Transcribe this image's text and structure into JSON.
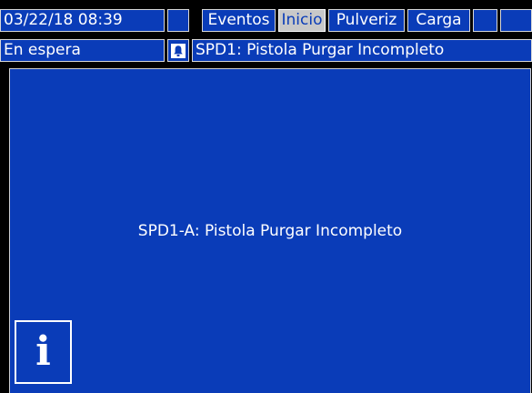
{
  "header": {
    "datetime": "03/22/18 08:39",
    "tabs": [
      {
        "label": "Eventos",
        "active": false
      },
      {
        "label": "Inicio",
        "active": true
      },
      {
        "label": "Pulveriz",
        "active": false
      },
      {
        "label": "Carga",
        "active": false
      }
    ]
  },
  "status": {
    "state": "En espera",
    "alarm_icon": "bell-icon",
    "alarm_message": "SPD1: Pistola Purgar Incompleto"
  },
  "main": {
    "message": "SPD1-A: Pistola Purgar Incompleto",
    "info_icon": "info-icon",
    "info_glyph": "i"
  },
  "colors": {
    "background": "#0a3cb8",
    "active_tab_background": "#c8c8c8",
    "frame": "#000000",
    "text": "#ffffff"
  }
}
